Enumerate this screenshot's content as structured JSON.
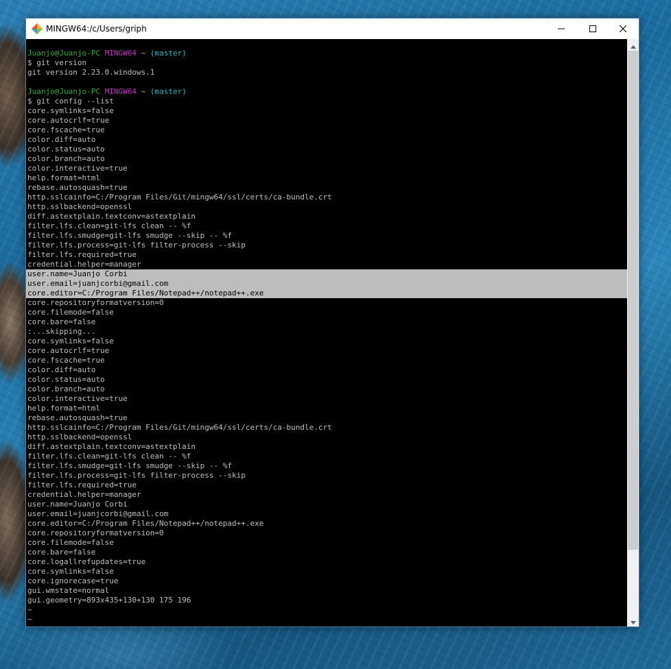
{
  "window": {
    "title": "MINGW64:/c/Users/griph"
  },
  "controls": {
    "minimize": "minimize-icon",
    "maximize": "maximize-icon",
    "close": "close-icon"
  },
  "colors": {
    "user": "#2ea82e",
    "shell": "#c032c0",
    "path": "#c9b72e",
    "branch": "#2ab6c4",
    "selection": "#bdbdbd"
  },
  "prompts": [
    {
      "user": "Juanjo@Juanjo-PC",
      "shell": "MINGW64",
      "path": "~",
      "branch": "(master)",
      "command": "$ git version"
    },
    {
      "user": "Juanjo@Juanjo-PC",
      "shell": "MINGW64",
      "path": "~",
      "branch": "(master)",
      "command": "$ git config --list"
    }
  ],
  "output_version": "git version 2.23.0.windows.1",
  "config_lines": [
    "core.symlinks=false",
    "core.autocrlf=true",
    "core.fscache=true",
    "color.diff=auto",
    "color.status=auto",
    "color.branch=auto",
    "color.interactive=true",
    "help.format=html",
    "rebase.autosquash=true",
    "http.sslcainfo=C:/Program Files/Git/mingw64/ssl/certs/ca-bundle.crt",
    "http.sslbackend=openssl",
    "diff.astextplain.textconv=astextplain",
    "filter.lfs.clean=git-lfs clean -- %f",
    "filter.lfs.smudge=git-lfs smudge --skip -- %f",
    "filter.lfs.process=git-lfs filter-process --skip",
    "filter.lfs.required=true",
    "credential.helper=manager",
    "user.name=Juanjo Corbi",
    "user.email=juanjcorbi@gmail.com",
    "core.editor=C:/Program Files/Notepad++/notepad++.exe",
    "core.repositoryformatversion=0",
    "core.filemode=false",
    "core.bare=false",
    ":...skipping...",
    "core.symlinks=false",
    "core.autocrlf=true",
    "core.fscache=true",
    "color.diff=auto",
    "color.status=auto",
    "color.branch=auto",
    "color.interactive=true",
    "help.format=html",
    "rebase.autosquash=true",
    "http.sslcainfo=C:/Program Files/Git/mingw64/ssl/certs/ca-bundle.crt",
    "http.sslbackend=openssl",
    "diff.astextplain.textconv=astextplain",
    "filter.lfs.clean=git-lfs clean -- %f",
    "filter.lfs.smudge=git-lfs smudge --skip -- %f",
    "filter.lfs.process=git-lfs filter-process --skip",
    "filter.lfs.required=true",
    "credential.helper=manager",
    "user.name=Juanjo Corbi",
    "user.email=juanjcorbi@gmail.com",
    "core.editor=C:/Program Files/Notepad++/notepad++.exe",
    "core.repositoryformatversion=0",
    "core.filemode=false",
    "core.bare=false",
    "core.logallrefupdates=true",
    "core.symlinks=false",
    "core.ignorecase=true",
    "gui.wmstate=normal",
    "gui.geometry=893x435+130+130 175 196",
    "~",
    "~"
  ],
  "selected_lines": [
    17,
    18,
    19
  ]
}
